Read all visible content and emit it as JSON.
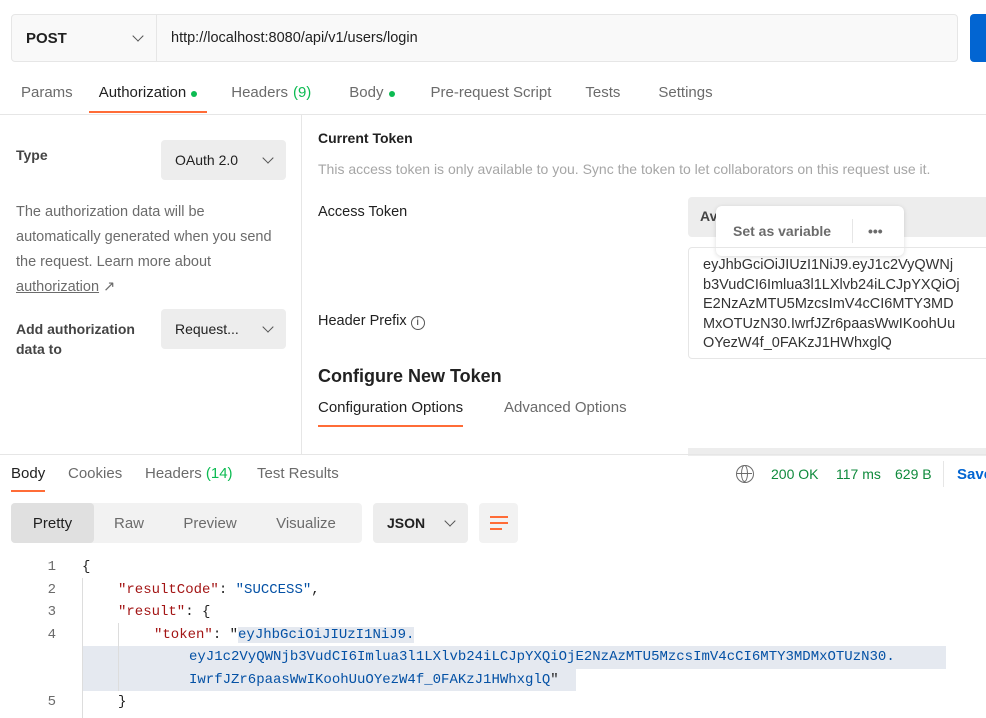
{
  "request": {
    "method": "POST",
    "url": "http://localhost:8080/api/v1/users/login"
  },
  "tabs": [
    {
      "label": "Params"
    },
    {
      "label": "Authorization",
      "dot": true
    },
    {
      "label": "Headers",
      "count": "(9)"
    },
    {
      "label": "Body",
      "dot": true
    },
    {
      "label": "Pre-request Script"
    },
    {
      "label": "Tests"
    },
    {
      "label": "Settings"
    }
  ],
  "auth": {
    "type_label": "Type",
    "type_value": "OAuth 2.0",
    "info_text": "The authorization data will be automatically generated when you send the request. Learn more about",
    "info_link": "authorization",
    "add_label": "Add authorization data to",
    "add_value": "Request..."
  },
  "token": {
    "current_title": "Current Token",
    "current_desc": "This access token is only available to you. Sync the token to let collaborators on this request use it.",
    "access_token_label": "Access Token",
    "access_token_select": "Av",
    "set_variable": "Set as variable",
    "more": "•••",
    "token_value": "eyJhbGciOiJIUzI1NiJ9.eyJ1c2VyQWNjb3VudCI6Imlua3l1LXlvb24iLCJpYXQiOjE2NzAzMTU5MzcsImV4cCI6MTY3MDMxOTUzN30.IwrfJZr6paasWwIKoohUuOYezW4f_0FAKzJ1HWhxglQ",
    "header_prefix_label": "Header Prefix",
    "configure_title": "Configure New Token",
    "config_tabs": [
      "Configuration Options",
      "Advanced Options"
    ]
  },
  "response": {
    "tabs": [
      {
        "label": "Body"
      },
      {
        "label": "Cookies"
      },
      {
        "label": "Headers",
        "count": "(14)"
      },
      {
        "label": "Test Results"
      }
    ],
    "status": "200 OK",
    "time": "117 ms",
    "size": "629 B",
    "save": "Save",
    "views": [
      "Pretty",
      "Raw",
      "Preview",
      "Visualize"
    ],
    "format": "JSON",
    "lines": [
      {
        "n": "1",
        "text": "{"
      },
      {
        "n": "2",
        "key": "\"resultCode\"",
        "sep": ": ",
        "val": "\"SUCCESS\"",
        "end": ","
      },
      {
        "n": "3",
        "key": "\"result\"",
        "sep": ": {"
      },
      {
        "n": "4",
        "key": "\"token\"",
        "sep": ": \"",
        "val": "eyJhbGciOiJIUzI1NiJ9.",
        "cont1": "eyJ1c2VyQWNjb3VudCI6Imlua3l1LXlvb24iLCJpYXQiOjE2NzAzMTU5MzcsImV4cCI6MTY3MDMxOTUzN30.",
        "cont2": "IwrfJZr6paasWwIKoohUuOYezW4f_0FAKzJ1HWhxglQ",
        "end": "\""
      },
      {
        "n": "5",
        "text": "}"
      }
    ]
  },
  "colors": {
    "accent": "#ff6c37",
    "send": "#0265d2",
    "ok": "#0f8a3c",
    "save": "#0265d2"
  }
}
